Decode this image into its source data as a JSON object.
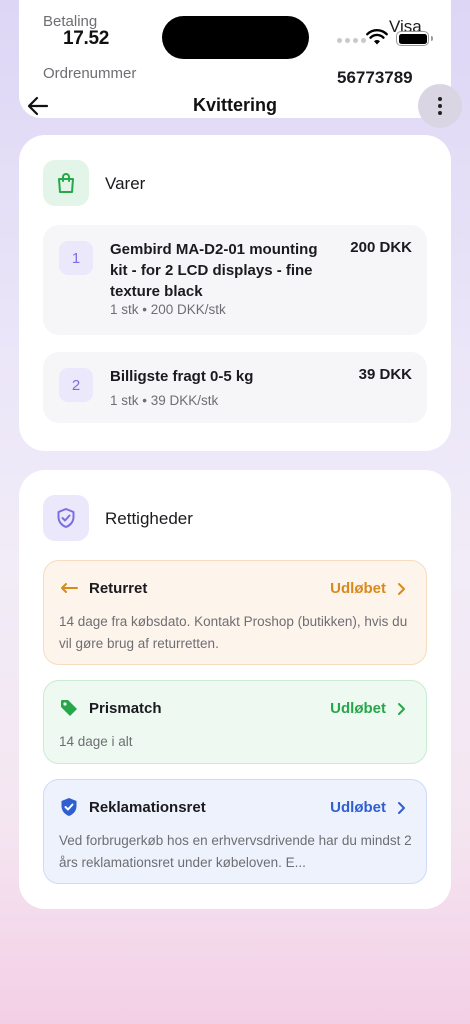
{
  "status_bar": {
    "time": "17.52"
  },
  "under_sheet": {
    "payment_label": "Betaling",
    "payment_value": "Visa",
    "order_label": "Ordrenummer",
    "order_value": "56773789"
  },
  "nav": {
    "title": "Kvittering"
  },
  "varer": {
    "title": "Varer",
    "items": [
      {
        "num": "1",
        "name": "Gembird MA-D2-01 mounting kit - for 2 LCD displays - fine texture black",
        "price": "200 DKK",
        "meta": "1 stk • 200 DKK/stk"
      },
      {
        "num": "2",
        "name": "Billigste fragt 0-5 kg",
        "price": "39 DKK",
        "meta": "1 stk • 39 DKK/stk"
      }
    ]
  },
  "rettigheder": {
    "title": "Rettigheder",
    "items": [
      {
        "title": "Returret",
        "status": "Udløbet",
        "desc": "14 dage fra købsdato. Kontakt Proshop (butikken), hvis du vil gøre brug af returretten.",
        "color": "#d98a1c",
        "icon": "return-arrow-icon"
      },
      {
        "title": "Prismatch",
        "status": "Udløbet",
        "desc": "14 dage i alt",
        "color": "#27a74a",
        "icon": "price-tag-icon"
      },
      {
        "title": "Reklamationsret",
        "status": "Udløbet",
        "desc": "Ved forbrugerkøb hos en erhvervsdrivende har du mindst 2 års reklamationsret under købeloven. E...",
        "color": "#2f5fd0",
        "icon": "shield-check-icon"
      }
    ]
  },
  "colors": {
    "accent_purple": "#7b6fe0",
    "green": "#27a74a",
    "orange": "#d98a1c",
    "blue": "#2f5fd0"
  }
}
